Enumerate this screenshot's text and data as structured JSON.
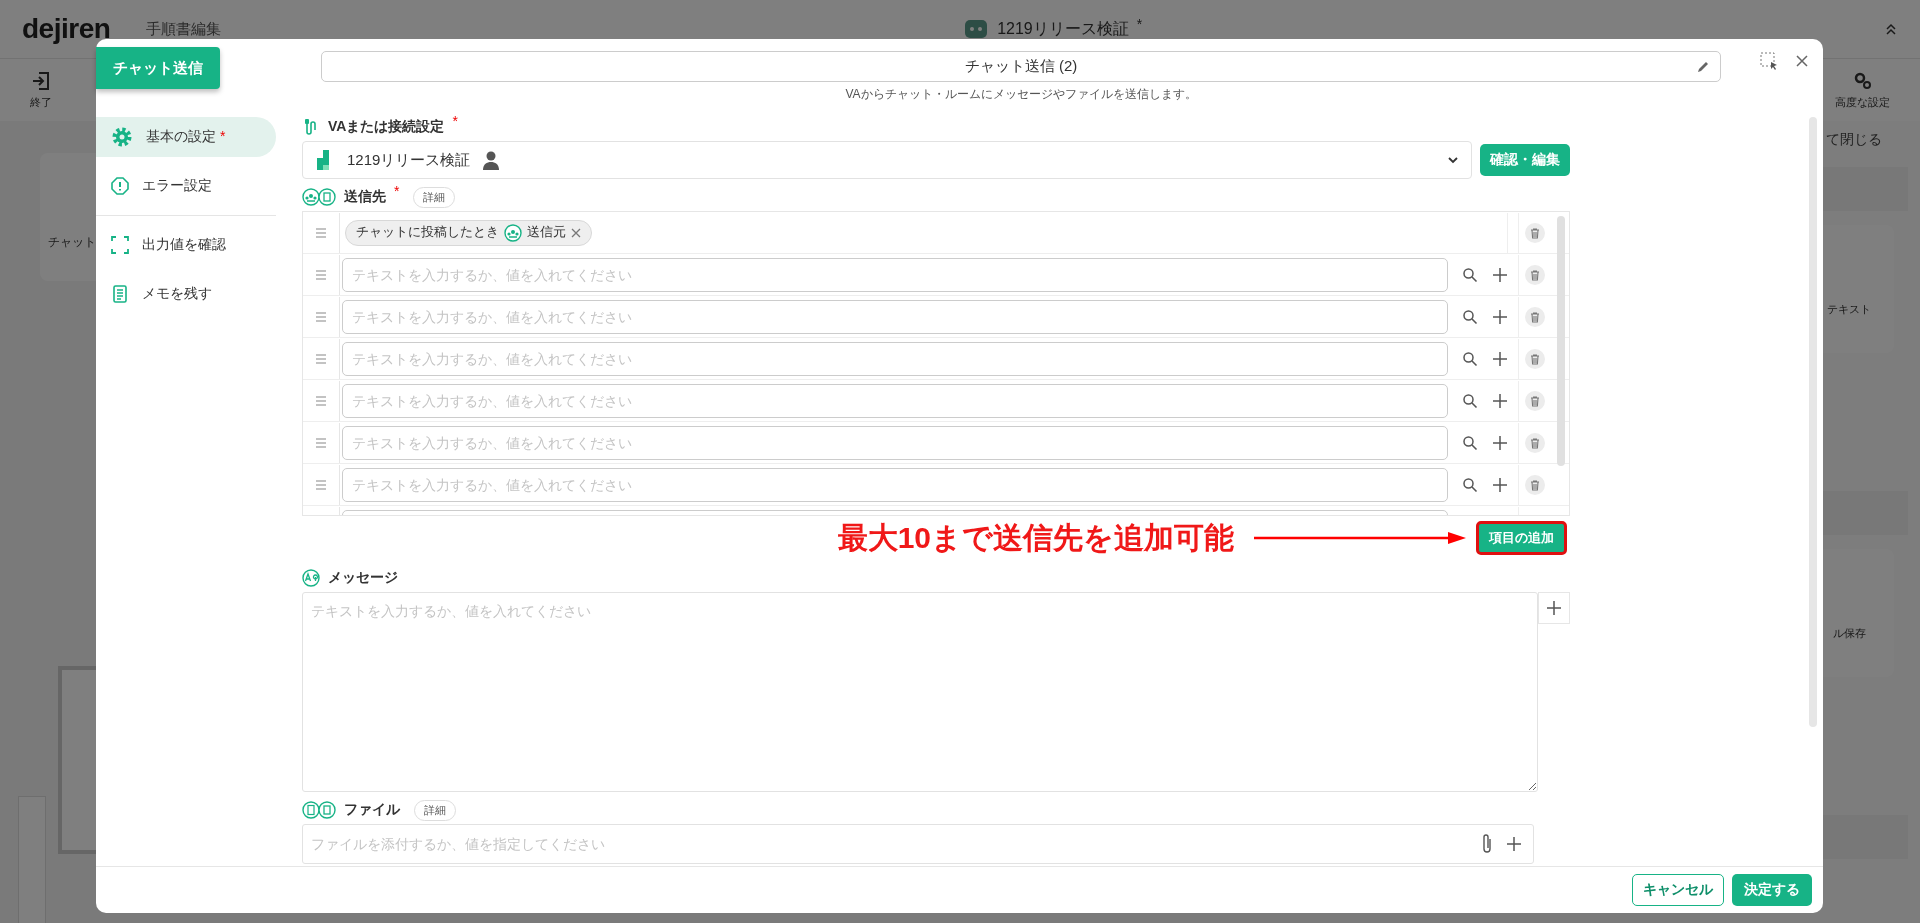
{
  "app": {
    "logo": "dejiren",
    "page_title": "手順書編集",
    "doc_title": "1219リリース検証",
    "modified_mark": "*",
    "toolbar": [
      {
        "label": "終了"
      },
      {
        "label": "高度な設定"
      }
    ],
    "collapse_all": "て閉じる",
    "canvas_card": {
      "label": "チャット"
    },
    "palette_cards": [
      {
        "label": "テキスト"
      },
      {
        "label": "ル保存"
      }
    ]
  },
  "dialog": {
    "tag": "チャット送信",
    "name_value": "チャット送信 (2)",
    "description": "VAからチャット・ルームにメッセージやファイルを送信します。",
    "nav": [
      {
        "kind": "gear",
        "label": "基本の設定",
        "required_mark": "*",
        "selected": true
      },
      {
        "kind": "alert",
        "label": "エラー設定",
        "selected": false
      },
      {
        "kind": "frame",
        "label": "出力値を確認",
        "selected": false
      },
      {
        "kind": "memo",
        "label": "メモを残す",
        "selected": false
      }
    ],
    "connection": {
      "label": "VAまたは接続設定",
      "required_mark": "*",
      "value": "1219リリース検証",
      "button": "確認・編集"
    },
    "recipients": {
      "label": "送信先",
      "required_mark": "*",
      "detail": "詳細",
      "add_button": "項目の追加",
      "rows": [
        {
          "kind": "chip",
          "chip_text": "チャットに投稿したとき",
          "chip_value": "送信元"
        },
        {
          "kind": "input",
          "placeholder": "テキストを入力するか、値を入れてください"
        },
        {
          "kind": "input",
          "placeholder": "テキストを入力するか、値を入れてください"
        },
        {
          "kind": "input",
          "placeholder": "テキストを入力するか、値を入れてください"
        },
        {
          "kind": "input",
          "placeholder": "テキストを入力するか、値を入れてください"
        },
        {
          "kind": "input",
          "placeholder": "テキストを入力するか、値を入れてください"
        },
        {
          "kind": "input",
          "placeholder": "テキストを入力するか、値を入れてください"
        },
        {
          "kind": "input"
        }
      ]
    },
    "annotation": "最大10まで送信先を追加可能",
    "message": {
      "label": "メッセージ",
      "placeholder": "テキストを入力するか、値を入れてください"
    },
    "file": {
      "label": "ファイル",
      "detail": "詳細",
      "placeholder": "ファイルを添付するか、値を指定してください"
    },
    "footer": {
      "cancel": "キャンセル",
      "ok": "決定する"
    }
  }
}
